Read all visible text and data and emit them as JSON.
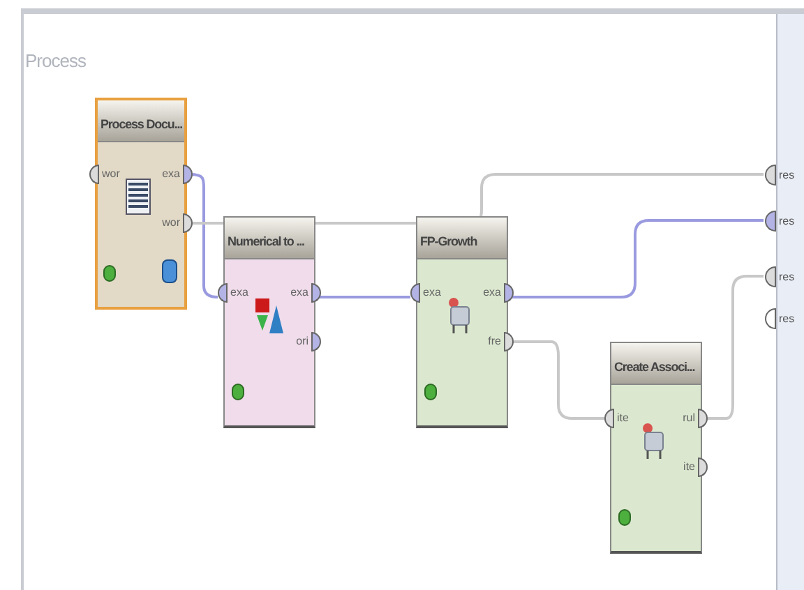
{
  "canvas": {
    "title": "Process"
  },
  "operators": [
    {
      "title": "Process Docu...",
      "kind": "documents",
      "color": "#e2d9c6",
      "selected": true,
      "inputs": [
        {
          "label": "wor",
          "color": "#dcdcdc"
        }
      ],
      "outputs": [
        {
          "label": "exa",
          "color": "#b3b3e6"
        },
        {
          "label": "wor",
          "color": "#dcdcdc"
        }
      ]
    },
    {
      "title": "Numerical to ...",
      "kind": "shapes",
      "color": "#f0dceb",
      "selected": false,
      "inputs": [
        {
          "label": "exa",
          "color": "#b3b3e6"
        }
      ],
      "outputs": [
        {
          "label": "exa",
          "color": "#b3b3e6"
        },
        {
          "label": "ori",
          "color": "#b3b3e6"
        }
      ]
    },
    {
      "title": "FP-Growth",
      "kind": "cart",
      "color": "#dbe8cf",
      "selected": false,
      "inputs": [
        {
          "label": "exa",
          "color": "#b3b3e6"
        }
      ],
      "outputs": [
        {
          "label": "exa",
          "color": "#b3b3e6"
        },
        {
          "label": "fre",
          "color": "#dcdcdc"
        }
      ]
    },
    {
      "title": "Create Associ...",
      "kind": "cart",
      "color": "#dbe8cf",
      "selected": false,
      "inputs": [
        {
          "label": "ite",
          "color": "#dcdcdc"
        }
      ],
      "outputs": [
        {
          "label": "rul",
          "color": "#dcdcdc"
        },
        {
          "label": "ite",
          "color": "#dcdcdc"
        }
      ]
    }
  ],
  "result_ports": [
    {
      "label": "res",
      "color": "#dcdcdc"
    },
    {
      "label": "res",
      "color": "#b3b3e6"
    },
    {
      "label": "res",
      "color": "#dcdcdc"
    },
    {
      "label": "res",
      "color": "#ffffff"
    }
  ]
}
